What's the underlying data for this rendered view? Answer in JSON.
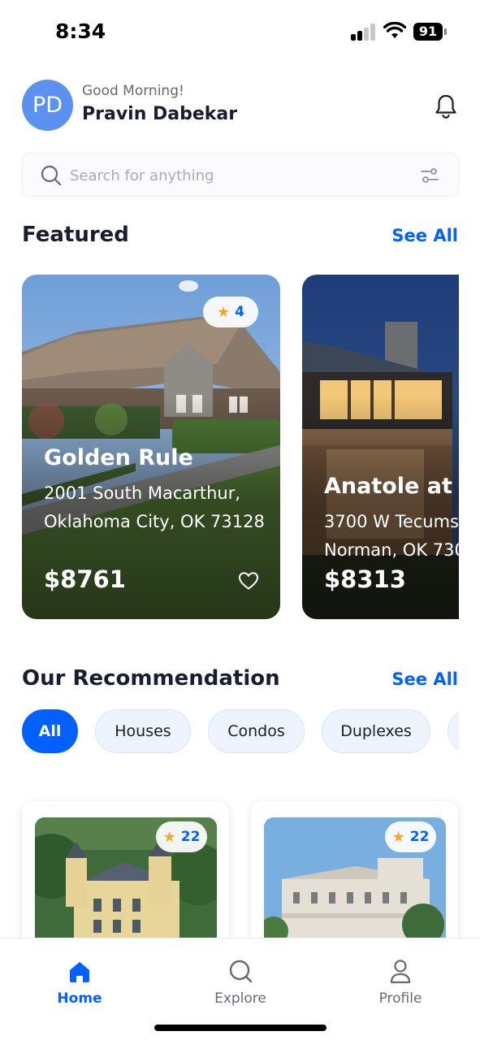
{
  "status_bar": {
    "time": "8:34",
    "battery": "91"
  },
  "header": {
    "avatar_initials": "PD",
    "greeting": "Good Morning!",
    "user_name": "Pravin Dabekar"
  },
  "search": {
    "placeholder": "Search for anything",
    "value": ""
  },
  "featured": {
    "title": "Featured",
    "see_all": "See All",
    "cards": [
      {
        "rating": "4",
        "name": "Golden Rule",
        "address": "2001 South Macarthur, Oklahoma City, OK 73128",
        "price": "$8761"
      },
      {
        "rating": "",
        "name": "Anatole at",
        "address": "3700 W Tecums Norman, OK 730",
        "price": "$8313"
      }
    ]
  },
  "recommendation": {
    "title": "Our Recommendation",
    "see_all": "See All",
    "filters": [
      {
        "label": "All",
        "active": true
      },
      {
        "label": "Houses",
        "active": false
      },
      {
        "label": "Condos",
        "active": false
      },
      {
        "label": "Duplexes",
        "active": false
      },
      {
        "label": "",
        "active": false
      }
    ],
    "cards": [
      {
        "rating": "22"
      },
      {
        "rating": "22"
      }
    ]
  },
  "bottom_nav": {
    "items": [
      {
        "label": "Home",
        "icon": "home-icon",
        "active": true
      },
      {
        "label": "Explore",
        "icon": "search-icon",
        "active": false
      },
      {
        "label": "Profile",
        "icon": "person-icon",
        "active": false
      }
    ]
  },
  "colors": {
    "accent": "#0061ff",
    "text_primary": "#191d31",
    "text_secondary": "#666876",
    "star": "#f5a623",
    "avatar": "#5b92f0"
  }
}
